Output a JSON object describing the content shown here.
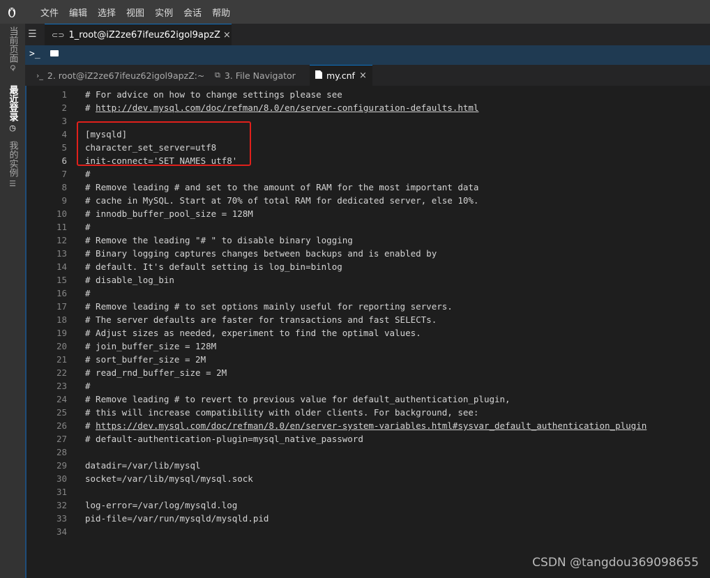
{
  "menubar": {
    "logo_icon": "linux-penguin-icon",
    "items": [
      "文件",
      "编辑",
      "选择",
      "视图",
      "实例",
      "会话",
      "帮助"
    ]
  },
  "sidebar": {
    "tabs": [
      {
        "label": "当前页面",
        "icon": "refresh-icon",
        "active": false
      },
      {
        "label": "最近登录",
        "icon": "clock-icon",
        "active": true
      },
      {
        "label": "我的实例",
        "icon": "list-icon",
        "active": false
      }
    ]
  },
  "session": {
    "tab_label": "1_root@iZ2ze67ifeuz62igol9apzZ",
    "close": "×"
  },
  "toolbar": {
    "terminal_icon": "terminal-icon",
    "folder_icon": "folder-icon"
  },
  "tabs": [
    {
      "label": "2. root@iZ2ze67ifeuz62igol9apzZ:~",
      "prefix": "›_",
      "active": false
    },
    {
      "label": "3. File Navigator",
      "prefix": "⧉",
      "active": false
    },
    {
      "label": "my.cnf",
      "prefix": "▇",
      "active": true,
      "close": "×"
    }
  ],
  "editor": {
    "current_line": 6,
    "lines": [
      "# For advice on how to change settings please see",
      "# http://dev.mysql.com/doc/refman/8.0/en/server-configuration-defaults.html",
      "",
      "[mysqld]",
      "character_set_server=utf8",
      "init-connect='SET NAMES utf8'",
      "#",
      "# Remove leading # and set to the amount of RAM for the most important data",
      "# cache in MySQL. Start at 70% of total RAM for dedicated server, else 10%.",
      "# innodb_buffer_pool_size = 128M",
      "#",
      "# Remove the leading \"# \" to disable binary logging",
      "# Binary logging captures changes between backups and is enabled by",
      "# default. It's default setting is log_bin=binlog",
      "# disable_log_bin",
      "#",
      "# Remove leading # to set options mainly useful for reporting servers.",
      "# The server defaults are faster for transactions and fast SELECTs.",
      "# Adjust sizes as needed, experiment to find the optimal values.",
      "# join_buffer_size = 128M",
      "# sort_buffer_size = 2M",
      "# read_rnd_buffer_size = 2M",
      "#",
      "# Remove leading # to revert to previous value for default_authentication_plugin,",
      "# this will increase compatibility with older clients. For background, see:",
      "# https://dev.mysql.com/doc/refman/8.0/en/server-system-variables.html#sysvar_default_authentication_plugin",
      "# default-authentication-plugin=mysql_native_password",
      "",
      "datadir=/var/lib/mysql",
      "socket=/var/lib/mysql/mysql.sock",
      "",
      "log-error=/var/log/mysqld.log",
      "pid-file=/var/run/mysqld/mysqld.pid",
      ""
    ],
    "link_lines": [
      2,
      26
    ]
  },
  "watermark": "CSDN @tangdou369098655",
  "colors": {
    "highlight_box": "#e0201b",
    "active_tab_border": "#0e70c0",
    "toolbar_bg": "#1f3a52"
  }
}
